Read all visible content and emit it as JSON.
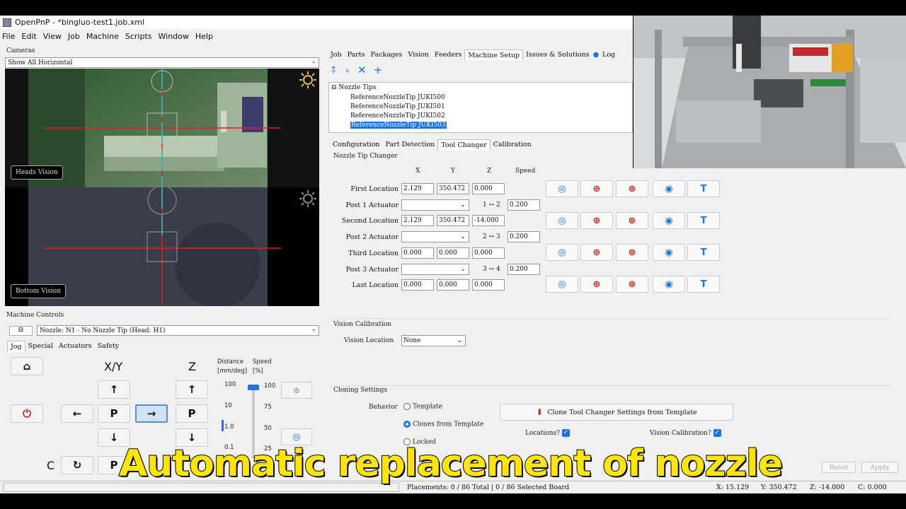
{
  "window": {
    "title": "OpenPnP - *bingluo-test1.job.xml"
  },
  "menu": [
    "File",
    "Edit",
    "View",
    "Job",
    "Machine",
    "Scripts",
    "Window",
    "Help"
  ],
  "cameras": {
    "label": "Cameras",
    "layout": "Show All Horizontal",
    "top_camera": "Heads Vision",
    "bottom_camera": "Bottom Vision"
  },
  "machine_controls": {
    "label": "Machine Controls",
    "nozzle": "Nozzle: N1 - No Nozzle Tip (Head: H1)",
    "tabs": [
      "Jog",
      "Special",
      "Actuators",
      "Safety"
    ],
    "xy_label": "X/Y",
    "z_label": "Z",
    "c_label": "C",
    "distance_label": "Distance",
    "distance_unit": "[mm/deg]",
    "speed_label": "Speed",
    "speed_unit": "[%]",
    "distance_ticks": [
      "100",
      "10",
      "1.0",
      "0.1"
    ],
    "speed_ticks": [
      "100",
      "75",
      "50",
      "25"
    ],
    "distance_selected": "1.0",
    "speed_percent": 100,
    "park_glyph": "P"
  },
  "main_tabs": [
    "Job",
    "Parts",
    "Packages",
    "Vision",
    "Feeders",
    "Machine Setup",
    "Issues & Solutions",
    "Log"
  ],
  "main_tab_active": "Machine Setup",
  "tree": {
    "root": "Nozzle Tips",
    "items": [
      "ReferenceNozzleTip JUKI500",
      "ReferenceNozzleTip JUKI501",
      "ReferenceNozzleTip JUKI502",
      "ReferenceNozzleTip JUKI503"
    ],
    "selected_index": 3
  },
  "detail_tabs": [
    "Configuration",
    "Part Detection",
    "Tool Changer",
    "Calibration"
  ],
  "detail_tab_active": "Tool Changer",
  "changer": {
    "title": "Nozzle Tip Changer",
    "headers": {
      "x": "X",
      "y": "Y",
      "z": "Z",
      "speed": "Speed"
    },
    "rows": [
      {
        "label": "First Location",
        "x": "2.129",
        "y": "350.472",
        "z": "0.000"
      },
      {
        "label": "Post 1 Actuator",
        "arrow": "1 ↔ 2",
        "speed": "0.200"
      },
      {
        "label": "Second Location",
        "x": "2.129",
        "y": "350.472",
        "z": "-14.000"
      },
      {
        "label": "Post 2 Actuator",
        "arrow": "2 ↔ 3",
        "speed": "0.200"
      },
      {
        "label": "Third Location",
        "x": "0.000",
        "y": "0.000",
        "z": "0.000"
      },
      {
        "label": "Post 3 Actuator",
        "arrow": "3 ↔ 4",
        "speed": "0.200"
      },
      {
        "label": "Last Location",
        "x": "0.000",
        "y": "0.000",
        "z": "0.000"
      }
    ]
  },
  "vision_cal": {
    "title": "Vision Calibration",
    "label": "Vision Location",
    "value": "None"
  },
  "cloning": {
    "title": "Cloning Settings",
    "behavior_label": "Behavior",
    "options": [
      "Template",
      "Clones from Template",
      "Locked"
    ],
    "selected": "Clones from Template",
    "clone_button": "Clone Tool Changer Settings from Template",
    "locations_label": "Locations?",
    "vision_cal_label": "Vision Calibration?"
  },
  "actions": {
    "reset": "Reset",
    "apply": "Apply"
  },
  "status": {
    "placements": "Placements: 0 / 86 Total | 0 / 86 Selected Board",
    "x": "X: 15.129",
    "y": "Y: 350.472",
    "z": "Z: -14.000",
    "c": "C: 0.000"
  },
  "caption": "Automatic replacement of nozzle",
  "colors": {
    "accent": "#1a73e8",
    "crosshair": "#e02020",
    "reticle": "#2ec4c4",
    "caption": "#ffe600"
  }
}
